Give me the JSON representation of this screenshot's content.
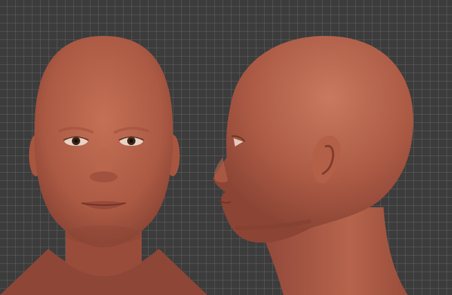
{
  "viewport": {
    "background": "#3c3c3c",
    "grid_color": "#787878",
    "views": [
      "front",
      "side"
    ]
  },
  "model": {
    "skin_color": "#b15f48",
    "skin_shadow": "#8a4433",
    "skin_highlight": "#c9785f",
    "eye_iris_color": "#3a2416"
  }
}
